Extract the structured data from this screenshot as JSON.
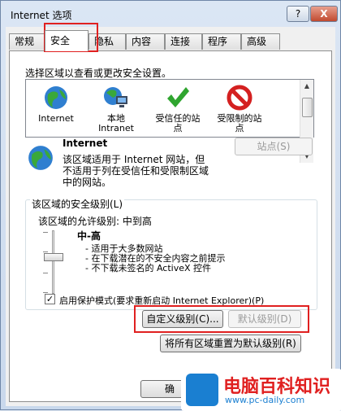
{
  "window": {
    "title": "Internet 选项",
    "help_label": "?",
    "close_label": "X"
  },
  "tabs": [
    "常规",
    "安全",
    "隐私",
    "内容",
    "连接",
    "程序",
    "高级"
  ],
  "instruction": "选择区域以查看或更改安全设置。",
  "zones": [
    {
      "label": "Internet",
      "icon": "globe-icon"
    },
    {
      "label": "本地\nIntranet",
      "icon": "local-intranet-icon"
    },
    {
      "label": "受信任的站\n点",
      "icon": "check-icon"
    },
    {
      "label": "受限制的站\n点",
      "icon": "forbidden-icon"
    }
  ],
  "selected_zone": {
    "name": "Internet",
    "desc1": "该区域适用于 Internet 网站，但",
    "desc2": "不适用于列在受信任和受限制区域",
    "desc3": "中的网站。",
    "sites_label": "站点(S)"
  },
  "security": {
    "group_title": "该区域的安全级别(L)",
    "allowed_levels": "该区域的允许级别: 中到高",
    "level_name": "中-高",
    "bullet1": "- 适用于大多数网站",
    "bullet2": "- 在下载潜在的不安全内容之前提示",
    "bullet3": "- 不下载未签名的 ActiveX 控件",
    "protected_mode": "启用保护模式(要求重新启动 Internet Explorer)(P)",
    "protected_checked": true,
    "custom_label": "自定义级别(C)...",
    "default_label": "默认级别(D)",
    "reset_all_label": "将所有区域重置为默认级别(R)"
  },
  "footer": {
    "ok_partial": "确"
  },
  "watermark": {
    "name": "电脑百科知识",
    "url": "www.pc-daily.com"
  },
  "colors": {
    "highlight": "#e02020",
    "accent": "#1a7fd1"
  }
}
